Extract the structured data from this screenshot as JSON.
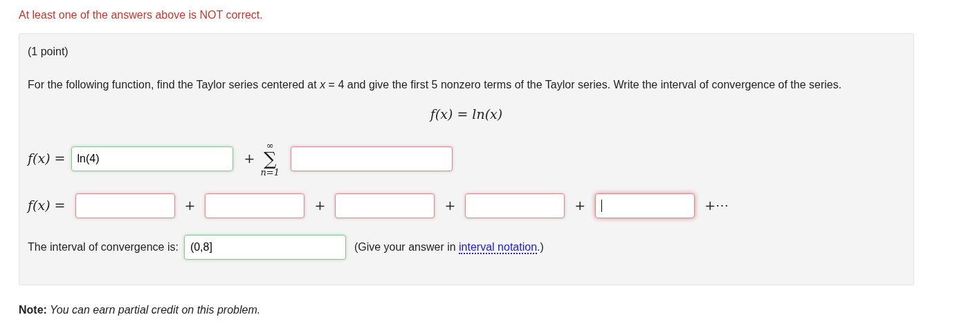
{
  "alert": "At least one of the answers above is NOT correct.",
  "problem": {
    "points": "(1 point)",
    "statement": "For the following function, find the Taylor series centered at *x* = 4 and give the first 5 nonzero terms of the Taylor series. Write the interval of convergence of the series.",
    "formula": "f(x) = ln(x)",
    "series_row": {
      "lhs": "f(x) =",
      "first": {
        "value": "ln(4)",
        "correct": true,
        "focused": false
      },
      "plus": "+",
      "sum_top": "∞",
      "sum_symbol": "∑",
      "sum_bottom": "n=1",
      "general": {
        "correct": false,
        "focused": false
      }
    },
    "terms_row": {
      "lhs": "f(x) =",
      "terms": [
        {
          "correct": false,
          "focused": false,
          "after": "+"
        },
        {
          "correct": false,
          "focused": false,
          "after": "+"
        },
        {
          "correct": false,
          "focused": false,
          "after": "+"
        },
        {
          "correct": false,
          "focused": false,
          "after": "+"
        },
        {
          "correct": false,
          "focused": true,
          "after": "+⋯"
        }
      ]
    },
    "interval_row": {
      "label": "The interval of convergence is:",
      "answer": {
        "value": "(0,8]",
        "correct": true,
        "focused": false
      },
      "hint_before": "(Give your answer in",
      "hint_link": "interval notation",
      "hint_after": ".)"
    }
  },
  "note": {
    "label": "Note:",
    "text": "You can earn partial credit on this problem."
  }
}
